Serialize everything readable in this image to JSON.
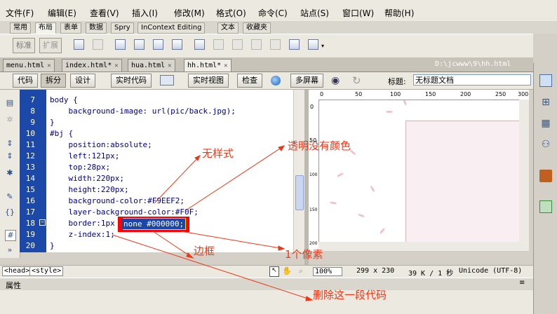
{
  "menu": [
    "文件(F)",
    "编辑(E)",
    "查看(V)",
    "插入(I)",
    "修改(M)",
    "格式(O)",
    "命令(C)",
    "站点(S)",
    "窗口(W)",
    "帮助(H)"
  ],
  "insert_tabs": [
    "常用",
    "布局",
    "表单",
    "数据",
    "Spry",
    "InContext Editing",
    "文本",
    "收藏夹"
  ],
  "insert_toolbar": {
    "standard": "标准",
    "expanded": "扩展"
  },
  "file_tabs": [
    "menu.html",
    "index.html*",
    "hua.html",
    "hh.html*"
  ],
  "file_path": "D:\\jcwww\\9\\hh.html",
  "doc_toolbar": {
    "code": "代码",
    "split": "拆分",
    "design": "设计",
    "live_code": "实时代码",
    "live_view": "实时视图",
    "inspect": "检查",
    "multiscreen": "多屏幕",
    "title_label": "标题:",
    "title_value": "无标题文档"
  },
  "code": {
    "line_numbers": [
      "7",
      "8",
      "9",
      "10",
      "11",
      "12",
      "13",
      "14",
      "15",
      "16",
      "17",
      "18",
      "19",
      "20"
    ],
    "lines": [
      "body {",
      "    background-image: url(pic/back.jpg);",
      "}",
      "#bj {",
      "    position:absolute;",
      "    left:121px;",
      "    top:28px;",
      "    width:220px;",
      "    height:220px;",
      "    background-color:#F9EEF2;",
      "    layer-background-color:#F0F;",
      "    border:1px",
      "    z-index:1;",
      "}"
    ],
    "selected_text": "none #000000;"
  },
  "ruler_labels": [
    "0",
    "50",
    "100",
    "150",
    "200",
    "250",
    "300"
  ],
  "vruler_labels": [
    "0",
    "50",
    "100",
    "150",
    "200"
  ],
  "status": {
    "tags": [
      "<head>",
      "<style>"
    ],
    "zoom": "100%",
    "size": "299 x 230",
    "weight": "39 K / 1 秒",
    "encoding": "Unicode (UTF-8)"
  },
  "properties_label": "属性",
  "annotations": {
    "no_style": "无样式",
    "transparent": "透明没有颜色",
    "border": "边框",
    "one_pixel": "1个像素",
    "delete_code": "删除这一段代码"
  },
  "colors": {
    "gutter": "#1c48a8",
    "annotation": "#e83a1a",
    "box_fill": "#F9EEF2"
  }
}
